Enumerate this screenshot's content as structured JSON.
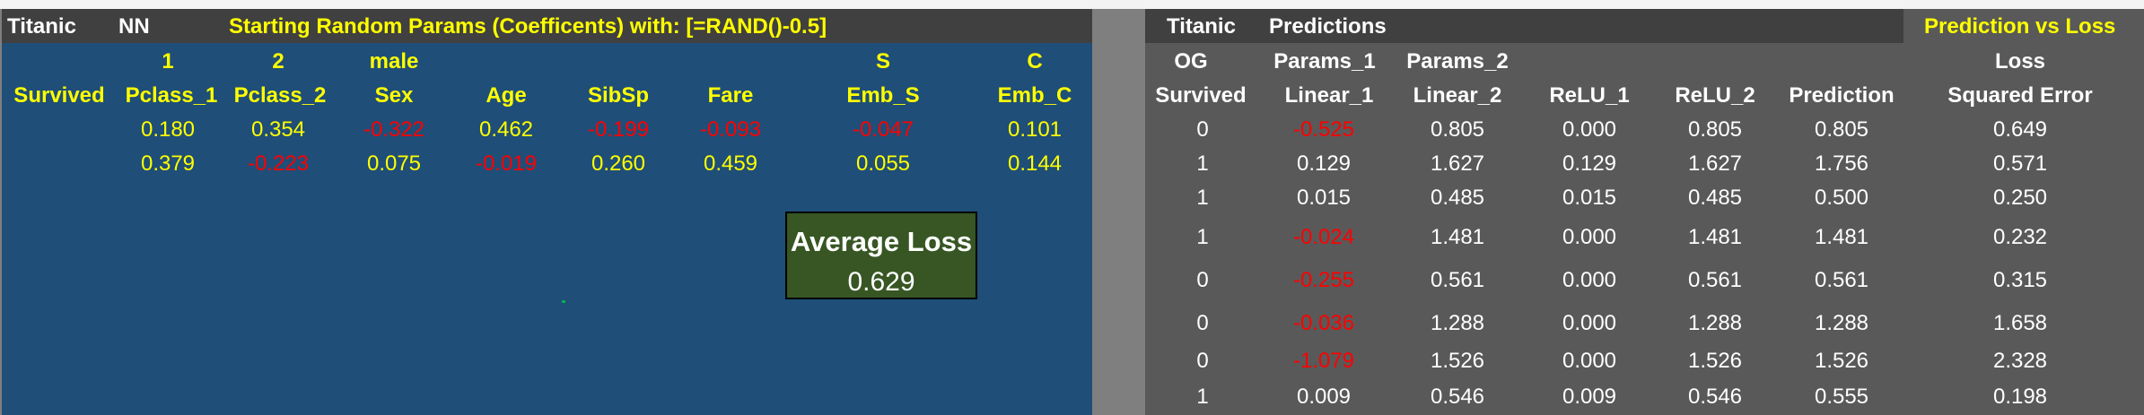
{
  "left_panel": {
    "header": {
      "titanic": "Titanic",
      "nn": "NN",
      "title": "Starting Random Params (Coefficents) with: [=RAND()-0.5]"
    },
    "top_labels": [
      "1",
      "2",
      "male",
      "S",
      "C"
    ],
    "columns": [
      "Survived",
      "Pclass_1",
      "Pclass_2",
      "Sex",
      "Age",
      "SibSp",
      "Fare",
      "Emb_S",
      "Emb_C"
    ],
    "params_rows": [
      [
        "0.180",
        "0.354",
        "-0.322",
        "0.462",
        "-0.199",
        "-0.093",
        "-0.047",
        "0.101"
      ],
      [
        "0.379",
        "-0.223",
        "0.075",
        "-0.019",
        "0.260",
        "0.459",
        "0.055",
        "0.144"
      ]
    ],
    "average_loss": {
      "label": "Average Loss",
      "value": "0.629"
    }
  },
  "right_panel": {
    "header": {
      "titanic": "Titanic",
      "predictions": "Predictions",
      "prediction_vs_loss": "Prediction vs Loss"
    },
    "group_labels": [
      "OG",
      "Params_1",
      "Params_2",
      "Loss"
    ],
    "columns": [
      "Survived",
      "Linear_1",
      "Linear_2",
      "ReLU_1",
      "ReLU_2",
      "Prediction",
      "Squared Error"
    ],
    "rows": [
      [
        "0",
        "-0.525",
        "0.805",
        "0.000",
        "0.805",
        "0.805",
        "0.649"
      ],
      [
        "1",
        "0.129",
        "1.627",
        "0.129",
        "1.627",
        "1.756",
        "0.571"
      ],
      [
        "1",
        "0.015",
        "0.485",
        "0.015",
        "0.485",
        "0.500",
        "0.250"
      ],
      [
        "1",
        "-0.024",
        "1.481",
        "0.000",
        "1.481",
        "1.481",
        "0.232"
      ],
      [
        "0",
        "-0.255",
        "0.561",
        "0.000",
        "0.561",
        "0.561",
        "0.315"
      ],
      [
        "0",
        "-0.036",
        "1.288",
        "0.000",
        "1.288",
        "1.288",
        "1.658"
      ],
      [
        "0",
        "-1.079",
        "1.526",
        "0.000",
        "1.526",
        "1.526",
        "2.328"
      ],
      [
        "1",
        "0.009",
        "0.546",
        "0.009",
        "0.546",
        "0.555",
        "0.198"
      ]
    ]
  },
  "colors": {
    "left_bg": "#1f4e78",
    "right_bg": "#595959",
    "header_bg": "#404040",
    "accent_yellow": "#ffff00",
    "negative_red": "#ff0000",
    "loss_box_bg": "#375623"
  }
}
